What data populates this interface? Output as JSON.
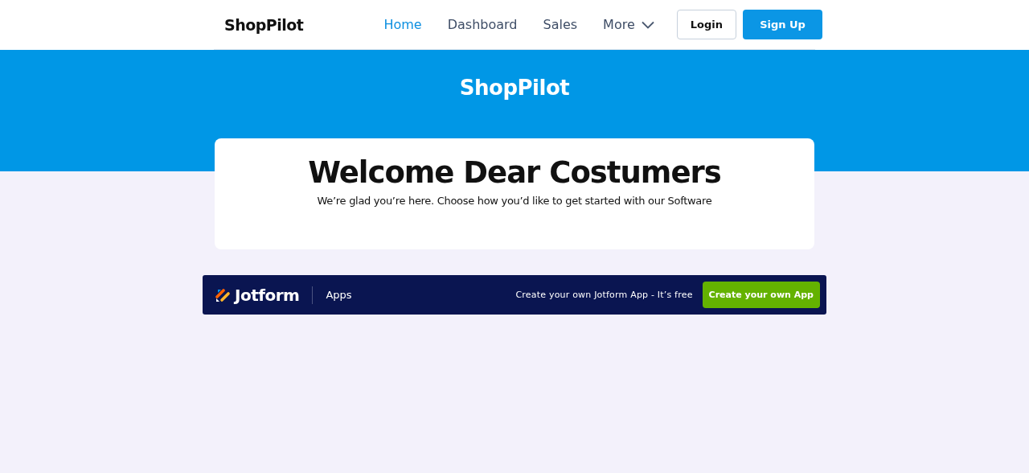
{
  "nav": {
    "brand": "ShopPilot",
    "links": [
      {
        "label": "Home",
        "selected": true
      },
      {
        "label": "Dashboard",
        "selected": false
      },
      {
        "label": "Sales",
        "selected": false
      },
      {
        "label": "More",
        "selected": false,
        "kind": "dropdown"
      }
    ],
    "buttons": [
      {
        "label": "Login",
        "kind": "outline"
      },
      {
        "label": "Sign Up",
        "kind": "primary"
      }
    ]
  },
  "hero": {
    "title": "ShopPilot"
  },
  "card": {
    "heading": "Welcome Dear Costumers",
    "text": "We’re glad you’re here. Choose how you’d like to get started with our Software"
  },
  "footer": {
    "brand": "Jotform",
    "section": "Apps",
    "promo": "Create your own Jotform App - It’s free",
    "button": "Create your own App"
  }
}
